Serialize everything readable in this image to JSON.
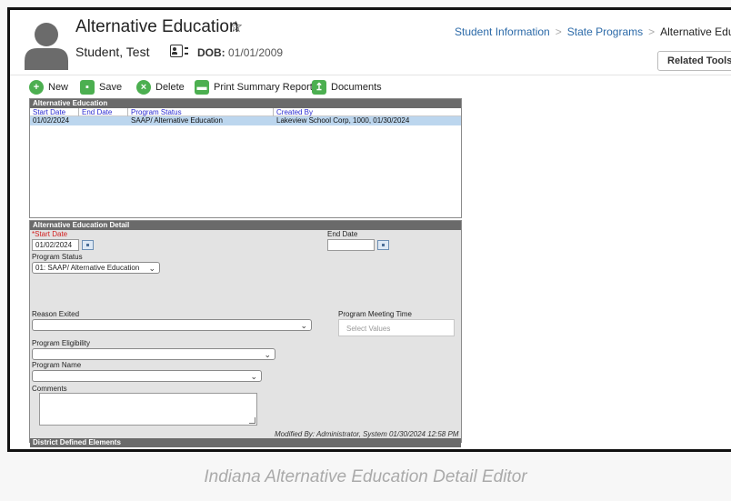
{
  "header": {
    "title": "Alternative Education",
    "student_name": "Student, Test",
    "dob_label": "DOB:",
    "dob_value": "01/01/2009",
    "related_tools": "Related Tools"
  },
  "breadcrumb": [
    "Student Information",
    "State Programs",
    "Alternative Education"
  ],
  "toolbar": {
    "new": "New",
    "save": "Save",
    "delete": "Delete",
    "print": "Print Summary Report",
    "documents": "Documents"
  },
  "list": {
    "title": "Alternative Education",
    "columns": [
      "Start Date",
      "End Date",
      "Program Status",
      "Created By"
    ],
    "rows": [
      [
        "01/02/2024",
        "",
        "SAAP/ Alternative Education",
        "Lakeview School Corp, 1000, 01/30/2024"
      ]
    ]
  },
  "detail": {
    "title": "Alternative Education Detail",
    "start_date_label": "*Start Date",
    "start_date_value": "01/02/2024",
    "end_date_label": "End Date",
    "end_date_value": "",
    "program_status_label": "Program Status",
    "program_status_value": "01: SAAP/ Alternative Education",
    "reason_exited_label": "Reason Exited",
    "reason_exited_value": "",
    "meeting_time_label": "Program Meeting Time",
    "meeting_time_placeholder": "Select Values",
    "eligibility_label": "Program Eligibility",
    "eligibility_value": "",
    "program_name_label": "Program Name",
    "program_name_value": "",
    "comments_label": "Comments",
    "comments_value": "",
    "modified_by": "Modified By: Administrator, System 01/30/2024 12:58 PM",
    "district_elements": "District Defined Elements"
  },
  "caption": "Indiana Alternative Education Detail Editor"
}
